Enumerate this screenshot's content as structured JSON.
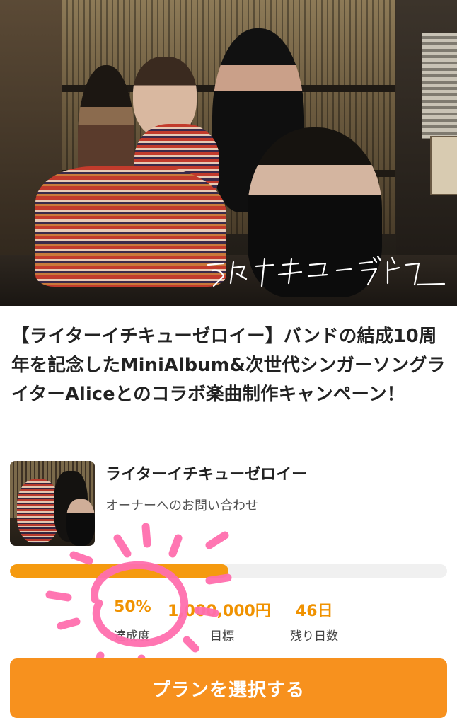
{
  "project": {
    "title": "【ライターイチキューゼロイー】バンドの結成10周年を記念したMiniAlbum&次世代シンガーソングライターAliceとのコラボ楽曲制作キャンペーン！",
    "hero_logo_text": "ライターイチキューゼロイー"
  },
  "owner": {
    "name": "ライターイチキューゼロイー",
    "contact_label": "オーナーへのお問い合わせ"
  },
  "funding": {
    "progress": 0.5,
    "achievement_value": "50%",
    "achievement_label": "達成度",
    "goal_value": "1,000,000円",
    "goal_label": "目標",
    "days_left_value": "46日",
    "days_left_label": "残り日数"
  },
  "cta": {
    "label": "プランを選択する"
  },
  "colors": {
    "accent": "#f59a0f",
    "stat_text": "#f09200",
    "cta_bg": "#f7911e",
    "doodle": "#ff6fae"
  }
}
